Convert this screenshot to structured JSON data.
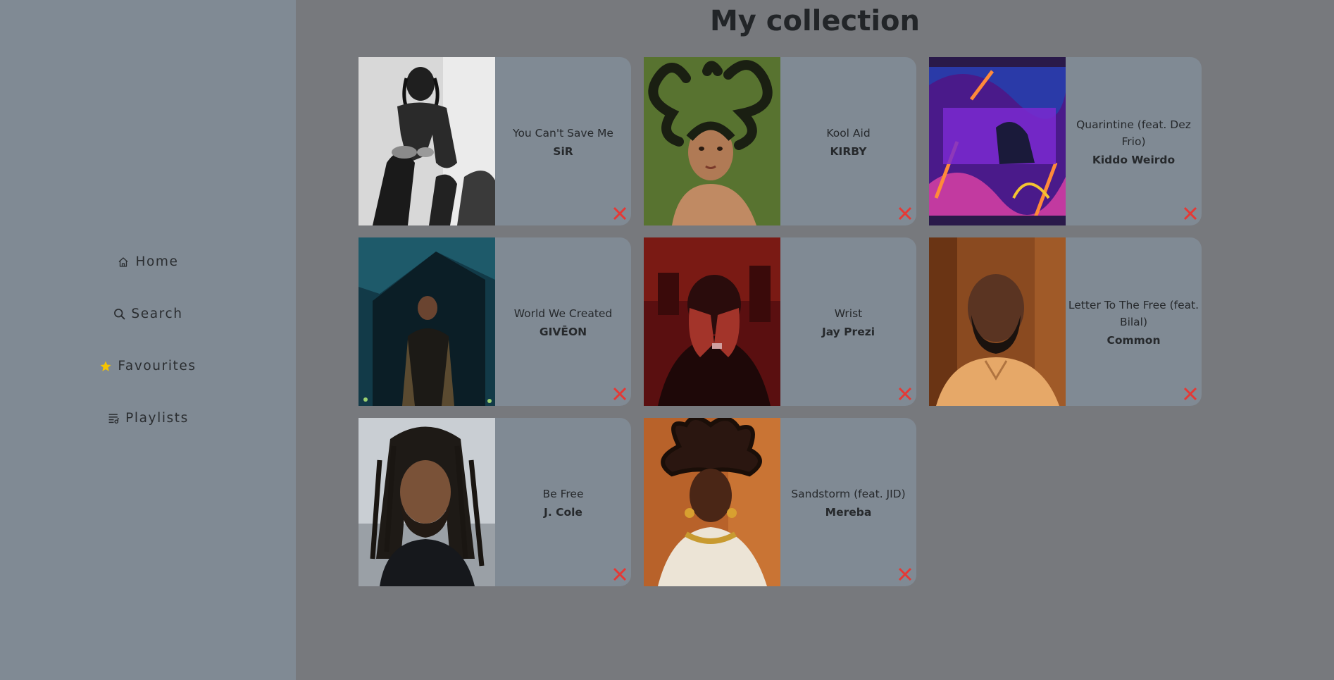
{
  "page": {
    "title": "My collection"
  },
  "sidebar": {
    "items": [
      {
        "label": "Home",
        "icon": "home-icon"
      },
      {
        "label": "Search",
        "icon": "search-icon"
      },
      {
        "label": "Favourites",
        "icon": "star-icon"
      },
      {
        "label": "Playlists",
        "icon": "playlist-icon"
      }
    ]
  },
  "colors": {
    "sidebar_bg": "#808a94",
    "main_bg": "#77797d",
    "card_bg": "#808a94",
    "remove_icon": "#e53935",
    "favourite_star": "#f5c400"
  },
  "tracks": [
    {
      "title": "You Can't Save Me",
      "artist": "SiR"
    },
    {
      "title": "Kool Aid",
      "artist": "KIRBY"
    },
    {
      "title": "Quarintine (feat. Dez Frio)",
      "artist": "Kiddo Weirdo"
    },
    {
      "title": "World We Created",
      "artist": "GIVĒON"
    },
    {
      "title": "Wrist",
      "artist": "Jay Prezi"
    },
    {
      "title": "Letter To The Free (feat. Bilal)",
      "artist": "Common"
    },
    {
      "title": "Be Free",
      "artist": "J. Cole"
    },
    {
      "title": "Sandstorm (feat. JID)",
      "artist": "Mereba"
    }
  ],
  "remove_icon": "close-x-icon"
}
